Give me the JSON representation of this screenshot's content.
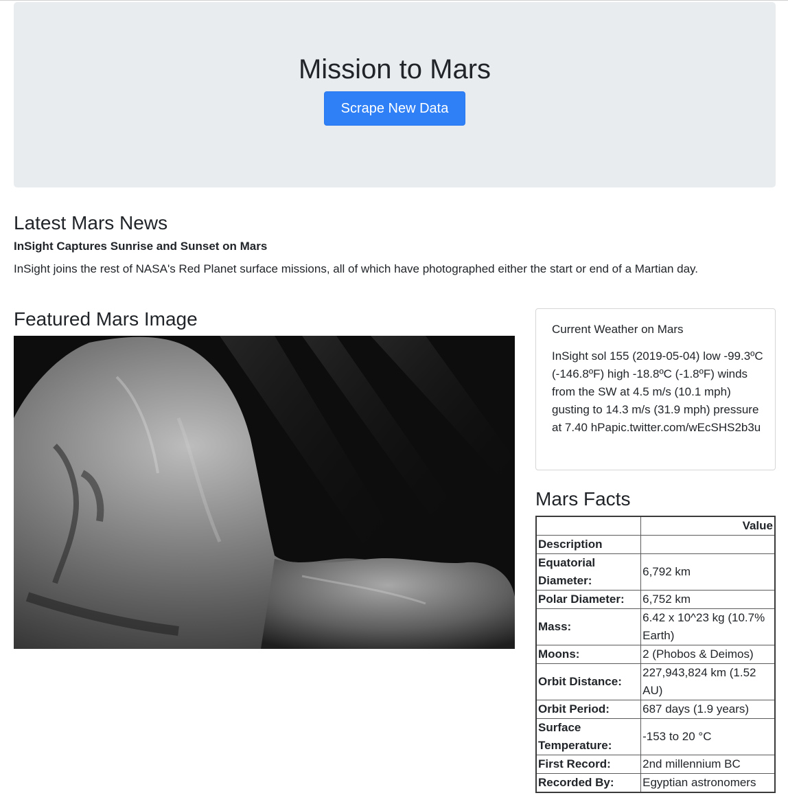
{
  "header": {
    "title": "Mission to Mars",
    "scrape_button_label": "Scrape New Data"
  },
  "news": {
    "section_title": "Latest Mars News",
    "headline": "InSight Captures Sunrise and Sunset on Mars",
    "teaser": "InSight joins the rest of NASA's Red Planet surface missions, all of which have photographed either the start or end of a Martian day."
  },
  "featured_image": {
    "section_title": "Featured Mars Image"
  },
  "weather": {
    "title": "Current Weather on Mars",
    "text": "InSight sol 155 (2019-05-04) low -99.3ºC (-146.8ºF) high -18.8ºC (-1.8ºF) winds from the SW at 4.5 m/s (10.1 mph) gusting to 14.3 m/s (31.9 mph) pressure at 7.40 hPapic.twitter.com/wEcSHS2b3u"
  },
  "facts": {
    "section_title": "Mars Facts",
    "header_value": "Value",
    "header_description": "Description",
    "rows": [
      {
        "label": "Equatorial Diameter:",
        "value": "6,792 km"
      },
      {
        "label": "Polar Diameter:",
        "value": "6,752 km"
      },
      {
        "label": "Mass:",
        "value": "6.42 x 10^23 kg (10.7% Earth)"
      },
      {
        "label": "Moons:",
        "value": "2 (Phobos & Deimos)"
      },
      {
        "label": "Orbit Distance:",
        "value": "227,943,824 km (1.52 AU)"
      },
      {
        "label": "Orbit Period:",
        "value": "687 days (1.9 years)"
      },
      {
        "label": "Surface Temperature:",
        "value": "-153 to 20 °C"
      },
      {
        "label": "First Record:",
        "value": "2nd millennium BC"
      },
      {
        "label": "Recorded By:",
        "value": "Egyptian astronomers"
      }
    ]
  }
}
